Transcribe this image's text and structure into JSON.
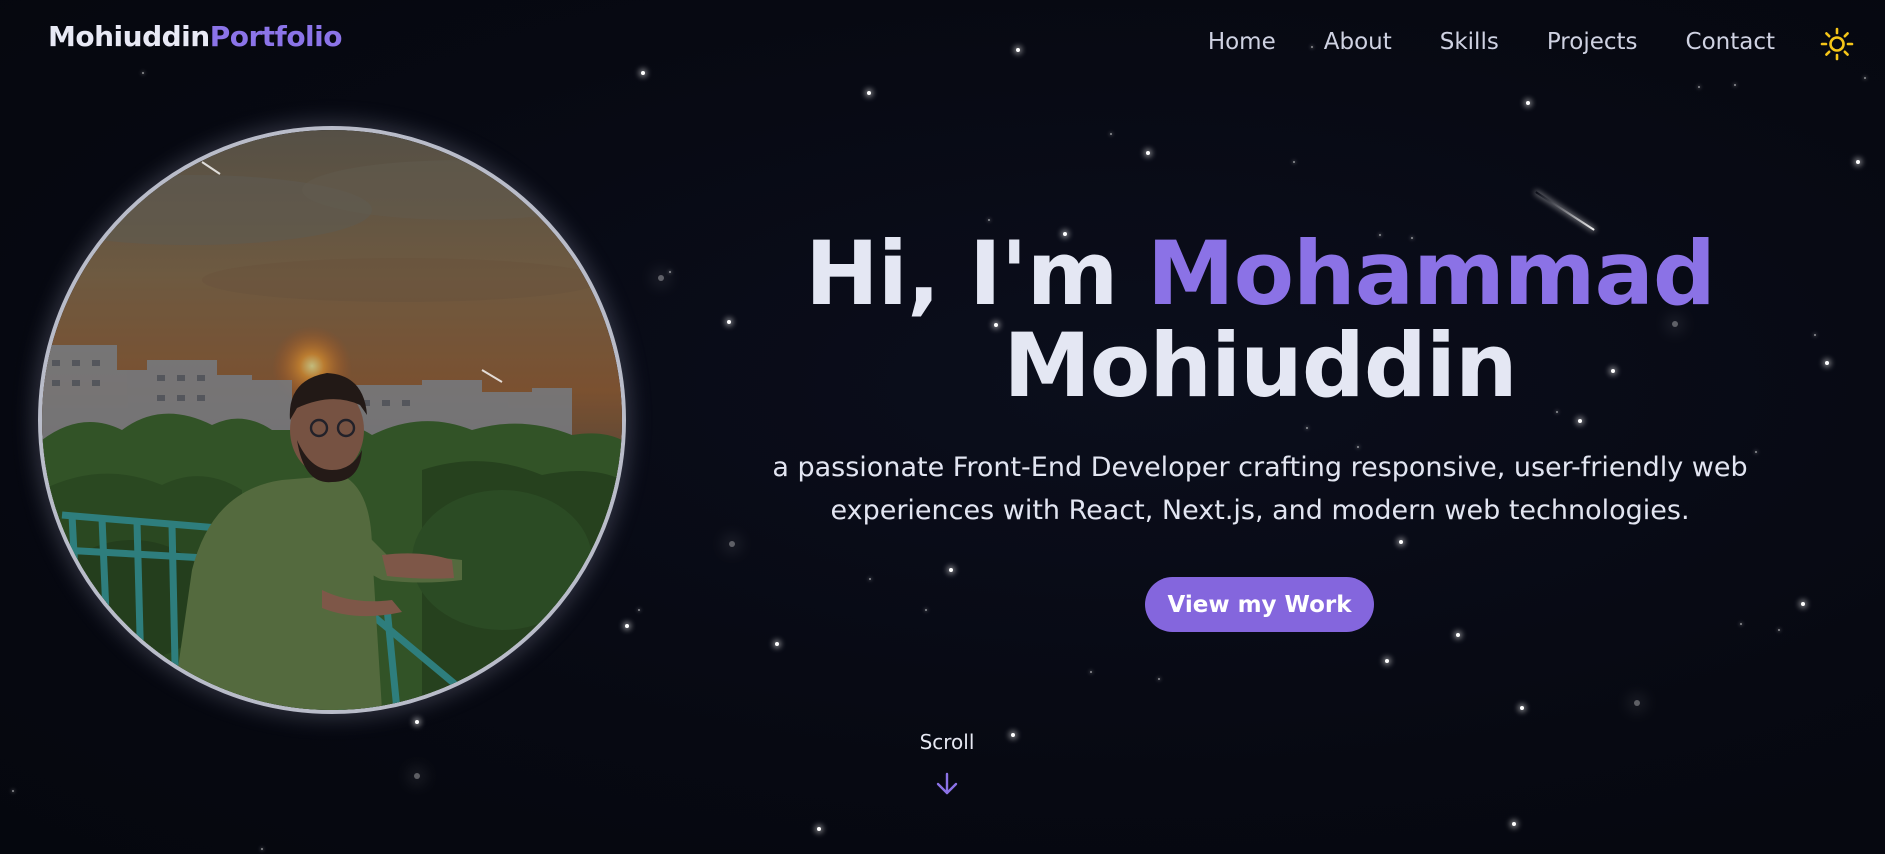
{
  "logo": {
    "first": "Mohiuddin",
    "second": "Portfolio"
  },
  "nav": {
    "items": [
      {
        "label": "Home"
      },
      {
        "label": "About"
      },
      {
        "label": "Skills"
      },
      {
        "label": "Projects"
      },
      {
        "label": "Contact"
      }
    ],
    "theme_toggle_icon": "sun-icon"
  },
  "hero": {
    "greeting": "Hi, I'm ",
    "name_first": "Mohammad",
    "name_last": "Mohiuddin",
    "subtitle": "a passionate Front-End Developer crafting responsive, user-friendly web experiences with React, Next.js, and modern web technologies.",
    "cta_label": "View my Work"
  },
  "scroll": {
    "label": "Scroll",
    "icon": "arrow-down-icon"
  },
  "avatar": {
    "icon": "profile-photo"
  },
  "colors": {
    "background": "#070912",
    "accent": "#8b72e6",
    "button": "#8466dd",
    "text": "#e4e7f3",
    "sun": "#f5c518"
  }
}
